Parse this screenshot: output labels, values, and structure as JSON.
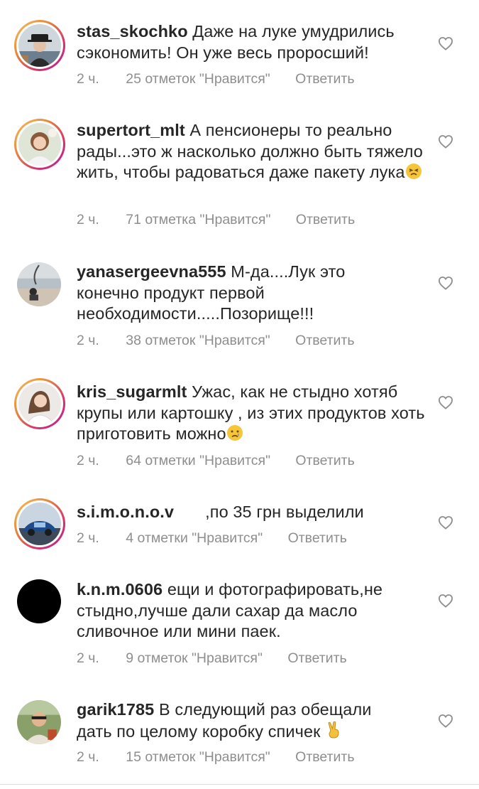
{
  "comments": [
    {
      "username": "stas_skochko",
      "text": "Даже на луке умудрились сэкономить! Он уже весь проросший!",
      "emoji": "",
      "time": "2 ч.",
      "likes": "25 отметок \"Нравится\"",
      "reply": "Ответить",
      "avatar_icon": "man-in-hat-avatar"
    },
    {
      "username": "supertort_mlt",
      "text": "А пенсионеры то реально рады...это ж насколько должно быть тяжело жить, чтобы радоваться даже пакету лука",
      "emoji": "persevering-face-emoji",
      "time": "2 ч.",
      "likes": "71 отметка \"Нравится\"",
      "reply": "Ответить",
      "avatar_icon": "woman-portrait-avatar"
    },
    {
      "username": "yanasergeevna555",
      "text": "М-да....Лук это конечно продукт первой необходимости.....Позорище!!!",
      "emoji": "",
      "time": "2 ч.",
      "likes": "38 отметок \"Нравится\"",
      "reply": "Ответить",
      "avatar_icon": "beach-avatar"
    },
    {
      "username": "kris_sugarmlt",
      "text": "Ужас, как не стыдно хотяб крупы или картошку , из этих продуктов хоть приготовить можно",
      "emoji": "crying-face-emoji",
      "time": "2 ч.",
      "likes": "64 отметки \"Нравится\"",
      "reply": "Ответить",
      "avatar_icon": "woman-white-shirt-avatar"
    },
    {
      "username": "s.i.m.o.n.o.v",
      "text": ",по 35 грн выделили",
      "emoji": "",
      "time": "2 ч.",
      "likes": "4 отметки \"Нравится\"",
      "reply": "Ответить",
      "avatar_icon": "car-avatar"
    },
    {
      "username": "k.n.m.0606",
      "text": "ещи и фотографировать,не стыдно,лучше дали сахар да масло сливочное или мини паек.",
      "emoji": "",
      "time": "2 ч.",
      "likes": "9 отметок \"Нравится\"",
      "reply": "Ответить",
      "avatar_icon": "black-avatar"
    },
    {
      "username": "garik1785",
      "text": "В следующий раз обещали дать по целому коробку спичек",
      "emoji": "victory-hand-emoji",
      "time": "2 ч.",
      "likes": "15 отметок \"Нравится\"",
      "reply": "Ответить",
      "avatar_icon": "man-outdoor-avatar"
    }
  ],
  "colors": {
    "text": "#262626",
    "meta": "#8e8e8e",
    "heart": "#8e8e8e"
  }
}
